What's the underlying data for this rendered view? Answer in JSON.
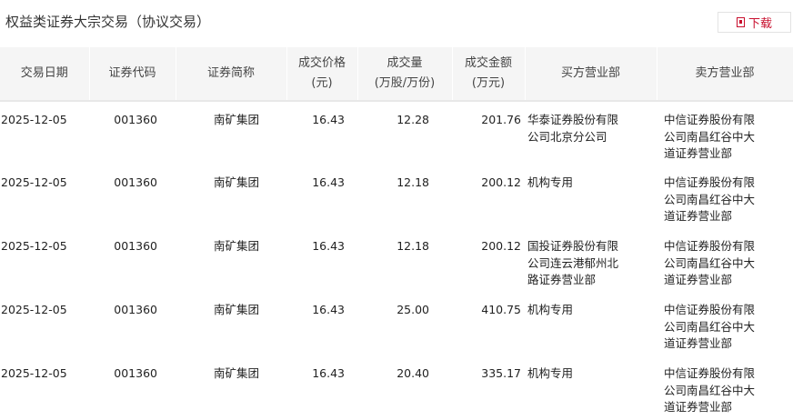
{
  "title": "权益类证券大宗交易（协议交易）",
  "download_label": "下载",
  "columns": [
    "交易日期",
    "证券代码",
    "证券简称",
    "成交价格\n(元)",
    "成交量\n(万股/万份)",
    "成交金额\n(万元)",
    "买方营业部",
    "卖方营业部"
  ],
  "rows": [
    {
      "date": "2025-12-05",
      "code": "001360",
      "name": "南矿集团",
      "price": "16.43",
      "volume": "12.28",
      "amount": "201.76",
      "buyer": "华泰证券股份有限公司北京分公司",
      "seller": "中信证券股份有限公司南昌红谷中大道证券营业部"
    },
    {
      "date": "2025-12-05",
      "code": "001360",
      "name": "南矿集团",
      "price": "16.43",
      "volume": "12.18",
      "amount": "200.12",
      "buyer": "机构专用",
      "seller": "中信证券股份有限公司南昌红谷中大道证券营业部"
    },
    {
      "date": "2025-12-05",
      "code": "001360",
      "name": "南矿集团",
      "price": "16.43",
      "volume": "12.18",
      "amount": "200.12",
      "buyer": "国投证券股份有限公司连云港郁州北路证券营业部",
      "seller": "中信证券股份有限公司南昌红谷中大道证券营业部"
    },
    {
      "date": "2025-12-05",
      "code": "001360",
      "name": "南矿集团",
      "price": "16.43",
      "volume": "25.00",
      "amount": "410.75",
      "buyer": "机构专用",
      "seller": "中信证券股份有限公司南昌红谷中大道证券营业部"
    },
    {
      "date": "2025-12-05",
      "code": "001360",
      "name": "南矿集团",
      "price": "16.43",
      "volume": "20.40",
      "amount": "335.17",
      "buyer": "机构专用",
      "seller": "中信证券股份有限公司南昌红谷中大道证券营业部"
    }
  ]
}
